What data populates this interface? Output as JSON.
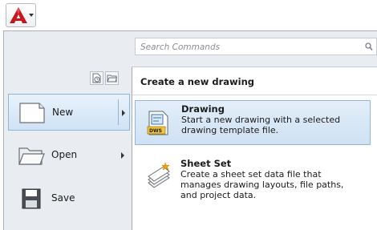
{
  "app_button": {
    "icon": "autocad-logo-icon",
    "accent": "#c8161d"
  },
  "search": {
    "placeholder": "Search Commands",
    "icon": "search-icon"
  },
  "toolbar": {
    "recent_icon": "recent-documents-icon",
    "open_docs_icon": "open-documents-icon"
  },
  "menu": {
    "items": [
      {
        "label": "New",
        "icon": "new-document-icon",
        "has_submenu": true,
        "active": true
      },
      {
        "label": "Open",
        "icon": "open-folder-icon",
        "has_submenu": true,
        "active": false
      },
      {
        "label": "Save",
        "icon": "save-disk-icon",
        "has_submenu": false,
        "active": false
      }
    ]
  },
  "submenu": {
    "title": "Create a new drawing",
    "items": [
      {
        "title": "Drawing",
        "desc": [
          "Start a new drawing with a selected",
          "drawing template file."
        ],
        "icon": "dws-drawing-icon",
        "tag": "DWS",
        "highlighted": true
      },
      {
        "title": "Sheet Set",
        "desc": [
          "Create a sheet set data file that",
          "manages drawing layouts, file paths,",
          "and project data."
        ],
        "icon": "sheet-set-icon",
        "highlighted": false
      }
    ]
  },
  "colors": {
    "highlight_border": "#8fb5d8",
    "highlight_fill": "#cfe2f4",
    "panel_bg": "#e9ecf0"
  }
}
